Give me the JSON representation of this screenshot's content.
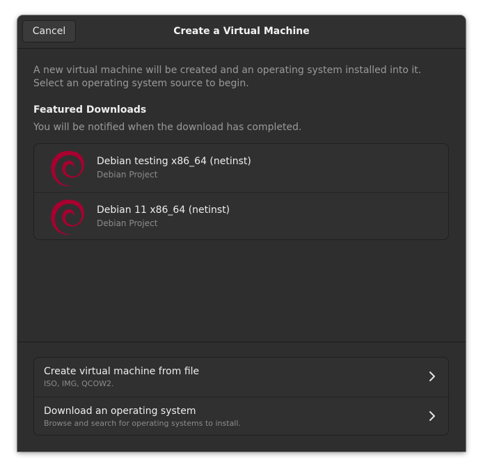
{
  "window": {
    "title": "Create a Virtual Machine",
    "cancel_label": "Cancel"
  },
  "intro": {
    "line1": "A new virtual machine will be created and an operating system installed into it.",
    "line2": "Select an operating system source to begin."
  },
  "featured": {
    "heading": "Featured Downloads",
    "subtitle": "You will be notified when the download has completed.",
    "items": [
      {
        "name": "Debian testing x86_64 (netinst)",
        "vendor": "Debian Project",
        "icon": "debian-logo-icon"
      },
      {
        "name": "Debian 11 x86_64 (netinst)",
        "vendor": "Debian Project",
        "icon": "debian-logo-icon"
      }
    ]
  },
  "sources": [
    {
      "title": "Create virtual machine from file",
      "subtitle": "ISO, IMG, QCOW2.",
      "icon": "chevron-right-icon"
    },
    {
      "title": "Download an operating system",
      "subtitle": "Browse and search for operating systems to install.",
      "icon": "chevron-right-icon"
    }
  ],
  "colors": {
    "background": "#2e2e2e",
    "debian_red": "#a80030",
    "text_primary": "#eeeeee",
    "text_dim": "#9a9a9a"
  }
}
